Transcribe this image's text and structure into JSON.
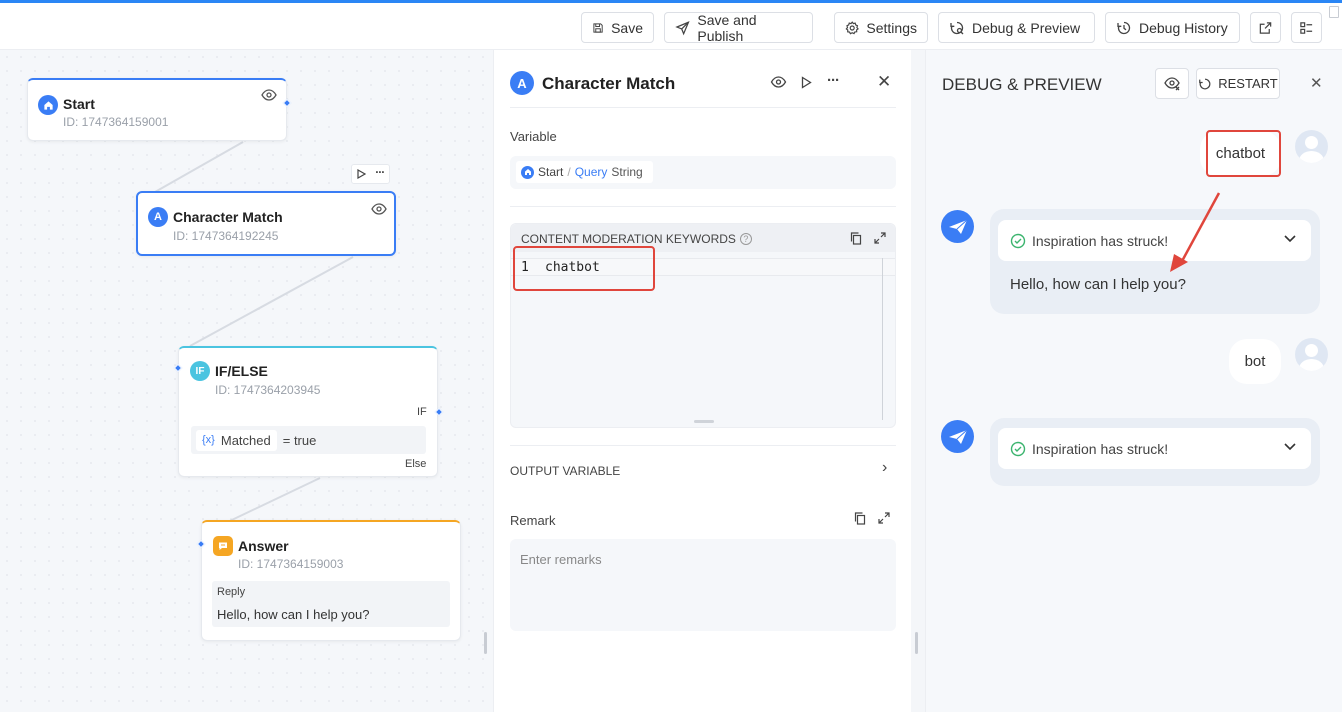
{
  "toolbar": {
    "save": "Save",
    "save_publish": "Save and Publish",
    "settings": "Settings",
    "debug_preview": "Debug & Preview",
    "debug_history": "Debug History"
  },
  "nodes": {
    "start": {
      "title": "Start",
      "id": "ID: 1747364159001",
      "icon_letter": ""
    },
    "character_match": {
      "title": "Character Match",
      "id": "ID: 1747364192245",
      "icon_letter": "A"
    },
    "ifelse": {
      "title": "IF/ELSE",
      "id": "ID: 1747364203945",
      "icon_letter": "IF",
      "if_label": "IF",
      "else_label": "Else",
      "cond_var": "Matched",
      "cond_op": "= true",
      "cond_prefix": "{x}"
    },
    "answer": {
      "title": "Answer",
      "id": "ID: 1747364159003",
      "reply_label": "Reply",
      "reply_text": "Hello, how can I help you?"
    }
  },
  "panel": {
    "title": "Character Match",
    "icon_letter": "A",
    "variable_label": "Variable",
    "var_source": "Start",
    "var_sep": "/",
    "var_name": "Query",
    "var_type": "String",
    "keywords_label": "CONTENT MODERATION KEYWORDS",
    "line_number": "1",
    "keyword": "chatbot",
    "output_label": "OUTPUT VARIABLE",
    "remark_label": "Remark",
    "remark_placeholder": "Enter remarks"
  },
  "debug": {
    "title": "DEBUG & PREVIEW",
    "restart": "RESTART",
    "messages": [
      {
        "role": "user",
        "text": "chatbot"
      },
      {
        "role": "bot",
        "status": "Inspiration has struck!",
        "text": "Hello, how can I help you?"
      },
      {
        "role": "user",
        "text": "bot"
      },
      {
        "role": "bot",
        "status": "Inspiration has struck!",
        "text": ""
      }
    ]
  },
  "colors": {
    "accent": "#2a86f5",
    "node_blue": "#3a7df5",
    "ifelse_teal": "#4bc4e0",
    "answer_orange": "#f5a623",
    "annotation_red": "#e0463c",
    "success_green": "#3bb46e"
  }
}
